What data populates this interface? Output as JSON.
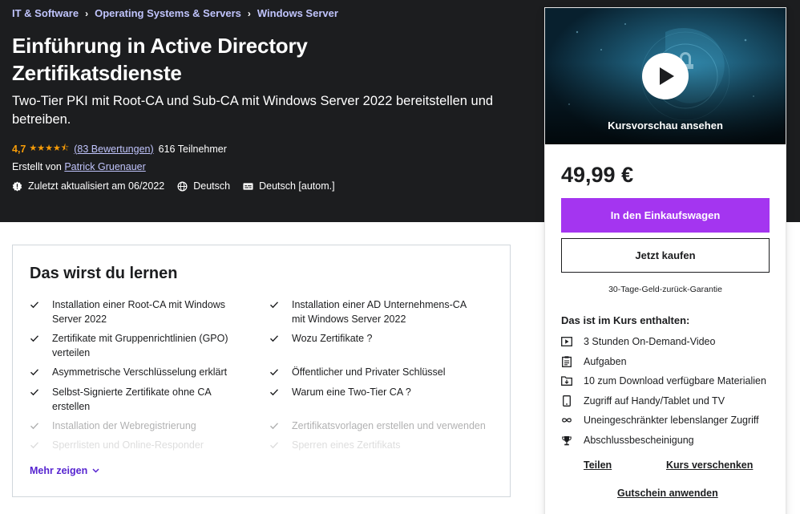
{
  "breadcrumbs": [
    "IT & Software",
    "Operating Systems & Servers",
    "Windows Server"
  ],
  "course": {
    "title": "Einführung in Active Directory Zertifikatsdienste",
    "subtitle": "Two-Tier PKI mit Root-CA und Sub-CA mit Windows Server 2022 bereitstellen und betreiben.",
    "rating": "4,7",
    "stars": "★★★★⯪",
    "rating_count": "(83 Bewertungen)",
    "participants": "616 Teilnehmer",
    "created_by_prefix": "Erstellt von",
    "instructor": "Patrick Gruenauer",
    "last_updated": "Zuletzt aktualisiert am 06/2022",
    "language": "Deutsch",
    "captions": "Deutsch [autom.]"
  },
  "learn": {
    "title": "Das wirst du lernen",
    "items": [
      "Installation einer Root-CA mit Windows Server 2022",
      "Installation einer AD Unternehmens-CA mit Windows Server 2022",
      "Zertifikate mit Gruppenrichtlinien (GPO) verteilen",
      "Wozu Zertifikate ?",
      "Asymmetrische Verschlüsselung erklärt",
      "Öffentlicher und Privater Schlüssel",
      "Selbst-Signierte Zertifikate ohne CA erstellen",
      "Warum eine Two-Tier CA ?",
      "Installation der Webregistrierung",
      "Zertifikatsvorlagen erstellen und verwenden",
      "Sperrlisten und Online-Responder",
      "Sperren eines Zertifikats"
    ],
    "more_label": "Mehr zeigen"
  },
  "sidebar": {
    "preview_label": "Kursvorschau ansehen",
    "price": "49,99 €",
    "cart_label": "In den Einkaufswagen",
    "buy_label": "Jetzt kaufen",
    "guarantee": "30-Tage-Geld-zurück-Garantie",
    "includes_title": "Das ist im Kurs enthalten:",
    "includes": [
      {
        "icon": "video-icon",
        "label": "3 Stunden On-Demand-Video"
      },
      {
        "icon": "assignment-icon",
        "label": "Aufgaben"
      },
      {
        "icon": "download-folder-icon",
        "label": "10 zum Download verfügbare Materialien"
      },
      {
        "icon": "mobile-icon",
        "label": "Zugriff auf Handy/Tablet und TV"
      },
      {
        "icon": "infinity-icon",
        "label": "Uneingeschränkter lebenslanger Zugriff"
      },
      {
        "icon": "trophy-icon",
        "label": "Abschlussbescheinigung"
      }
    ],
    "share_label": "Teilen",
    "gift_label": "Kurs verschenken",
    "coupon_label": "Gutschein anwenden"
  },
  "colors": {
    "hero_bg": "#1c1d1f",
    "link_purple": "#c0c4fc",
    "star": "#f69c08",
    "cart_button": "#a435f0",
    "more_link": "#5624d0"
  }
}
